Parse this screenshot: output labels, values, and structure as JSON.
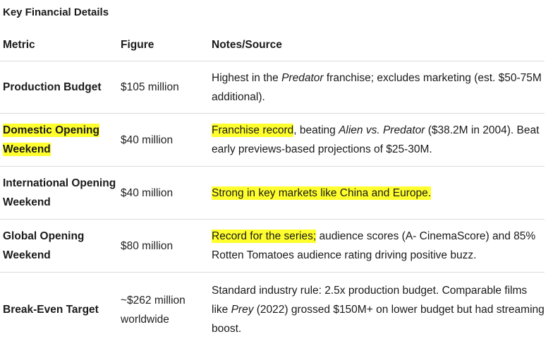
{
  "title": "Key Financial Details",
  "columns": [
    "Metric",
    "Figure",
    "Notes/Source"
  ],
  "rows": [
    {
      "metric": "Production Budget",
      "figure": "$105 million",
      "notes": {
        "n1": "Highest in the ",
        "n2": "Predator",
        "n3": " franchise; excludes marketing (est. $50-75M additional)."
      }
    },
    {
      "metric": "Domestic Opening Weekend",
      "figure": "$40 million",
      "notes": {
        "n1": "Franchise record",
        "n2": ", beating ",
        "n3": "Alien vs. Predator",
        "n4": " ($38.2M in 2004). Beat early previews-based projections of $25-30M."
      }
    },
    {
      "metric": "International Opening Weekend",
      "figure": "$40 million",
      "notes": {
        "n1": "Strong in key markets like China and Europe."
      }
    },
    {
      "metric": "Global Opening Weekend",
      "figure": "$80 million",
      "notes": {
        "n1": "Record for the series;",
        "n2": " audience scores (A- CinemaScore) and 85% Rotten Tomatoes audience rating driving positive buzz."
      }
    },
    {
      "metric": "Break-Even Target",
      "figure": "~$262 million worldwide",
      "notes": {
        "n1": "Standard industry rule: 2.5x production budget. Comparable films like ",
        "n2": "Prey",
        "n3": " (2022) grossed $150M+ on lower budget but had streaming boost."
      }
    }
  ],
  "colors": {
    "highlight": "#ffff2e",
    "divider": "#dcdcdc",
    "text": "#1a1a1a"
  }
}
